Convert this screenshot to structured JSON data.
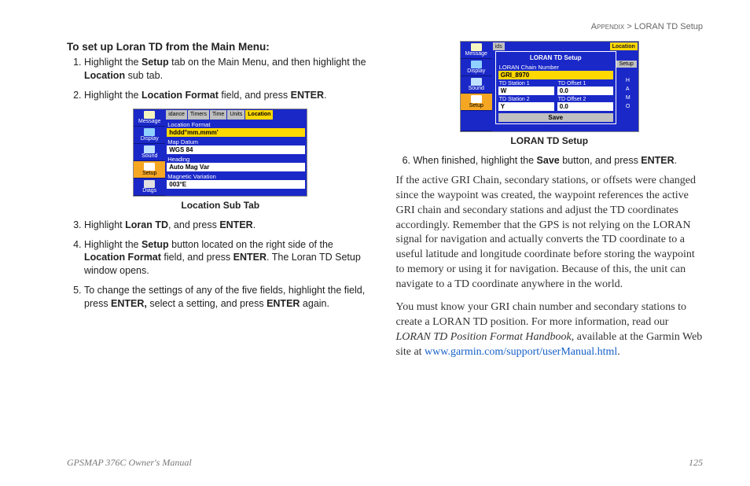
{
  "header": {
    "left": "Appendix >",
    "right": "LORAN TD Setup"
  },
  "left_column": {
    "title": "To set up Loran TD from the Main Menu:",
    "steps_a": [
      {
        "pre": "Highlight the ",
        "b1": "Setup",
        "mid": " tab on the Main Menu, and then highlight the ",
        "b2": "Location",
        "post": " sub tab."
      },
      {
        "pre": "Highlight the ",
        "b1": "Location Format",
        "mid": " field, and press ",
        "b2": "ENTER",
        "post": "."
      }
    ],
    "screenshot1": {
      "sidebar": [
        "Message",
        "Display",
        "Sound",
        "Setup",
        "Diags"
      ],
      "tabs": [
        "idance",
        "Timers",
        "Time",
        "Units",
        "Location"
      ],
      "fields": {
        "loc_fmt_label": "Location Format",
        "loc_fmt_val": "hddd°mm.mmm'",
        "datum_label": "Map Datum",
        "datum_val": "WGS 84",
        "heading_label": "Heading",
        "heading_val": "Auto Mag Var",
        "magvar_label": "Magnetic Variation",
        "magvar_val": "003°E"
      },
      "caption": "Location Sub Tab"
    },
    "steps_b": [
      {
        "pre": "Highlight ",
        "b1": "Loran TD",
        "mid": ", and press ",
        "b2": "ENTER",
        "post": "."
      },
      {
        "pre": "Highlight the ",
        "b1": "Setup",
        "mid": " button located on the right side of the ",
        "b2": "Location Format",
        "mid2": " field, and press ",
        "b3": "ENTER",
        "post": ". The Loran TD Setup window opens."
      },
      {
        "pre": "To change the settings of any of the five fields, highlight the field, press ",
        "b1": "ENTER,",
        "mid": " select a setting, and press ",
        "b2": "ENTER",
        "post": " again."
      }
    ]
  },
  "right_column": {
    "screenshot2": {
      "popup_title": "LORAN TD Setup",
      "chain_label": "LORAN Chain Number",
      "chain_val": "GRI_8970",
      "td1_s_label": "TD Station 1",
      "td1_s_val": "W",
      "td1_o_label": "TD Offset 1",
      "td1_o_val": "0.0",
      "td2_s_label": "TD Station 2",
      "td2_s_val": "Y",
      "td2_o_label": "TD Offset 2",
      "td2_o_val": "0.0",
      "save": "Save",
      "setup_btn": "Setup",
      "tab_ids": "ids",
      "tab_loc": "Location",
      "ham": [
        "H",
        "A",
        "M",
        "O"
      ],
      "caption": "LORAN TD Setup"
    },
    "step6": {
      "pre": "When finished, highlight the ",
      "b1": "Save",
      "mid": " button, and press ",
      "b2": "ENTER",
      "post": "."
    },
    "para1_a": "If the active GRI Chain, secondary stations, or offsets were changed since the waypoint was created, the waypoint references the active GRI chain and secondary stations and adjust the TD coordinates accordingly. Remember that the GPS is not relying on the LORAN signal for navigation and actually converts the TD coordinate to a useful latitude and longitude coordinate before storing the waypoint to memory or using it for navigation. Because of this, the unit can navigate to a TD coordinate anywhere in the world.",
    "para2_a": "You must know your GRI chain number and secondary stations to create a LORAN TD position. For more information, read our ",
    "para2_i": "LORAN TD Position Format Handbook",
    "para2_b": ", available at the Garmin Web site at ",
    "para2_link": "www.garmin.com/support/userManual.html",
    "para2_c": "."
  },
  "footer": {
    "left": "GPSMAP 376C Owner's Manual",
    "right": "125"
  }
}
